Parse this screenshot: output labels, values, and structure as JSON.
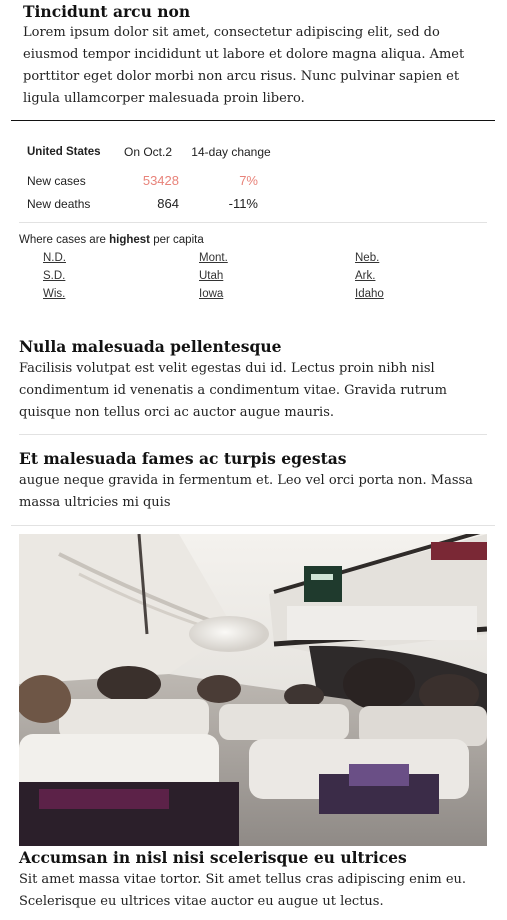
{
  "story1": {
    "headline": "Tincidunt arcu non",
    "summary": "Lorem ipsum dolor sit amet, consectetur adipiscing elit, sed do eiusmod tempor incididunt ut labore et dolore magna aliqua. Amet porttitor eget dolor morbi non arcu risus. Nunc pulvinar sapien et ligula ullamcorper malesuada proin libero."
  },
  "tracker": {
    "col_region": "United States",
    "col_date": "On Oct.2",
    "col_change": "14-day change",
    "rows": [
      {
        "label": "New cases",
        "value": "53428",
        "change": "7%"
      },
      {
        "label": "New deaths",
        "value": "864",
        "change": "-11%"
      }
    ],
    "highest_prefix": "Where cases are ",
    "highest_bold": "highest",
    "highest_suffix": " per capita",
    "states": [
      "N.D.",
      "Mont.",
      "Neb.",
      "S.D.",
      "Utah",
      "Ark.",
      "Wis.",
      "Iowa",
      "Idaho"
    ],
    "colors": {
      "increase": "#e8837a",
      "text": "#222222"
    }
  },
  "story2": {
    "headline": "Nulla malesuada pellentesque",
    "summary": "Facilisis volutpat est velit egestas dui id. Lectus proin nibh nisl condimentum id venenatis a condimentum vitae. Gravida rutrum quisque non tellus orci ac auctor augue mauris."
  },
  "story3": {
    "headline": "Et malesuada fames ac turpis egestas",
    "summary": "augue neque gravida in fermentum et. Leo vel orci porta non. Massa massa ultricies mi quis"
  },
  "story4": {
    "headline": "Accumsan in nisl nisi scelerisque eu ultrices",
    "summary": "Sit amet massa vitae tortor. Sit amet tellus cras adipiscing enim eu. Scelerisque eu ultrices vitae auctor eu augue ut lectus."
  }
}
